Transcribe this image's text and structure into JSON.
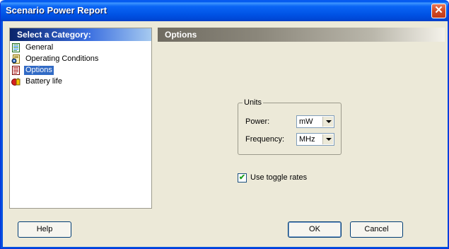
{
  "window": {
    "title": "Scenario Power Report",
    "close_glyph": "✕"
  },
  "sidebar": {
    "header": "Select a Category:",
    "items": [
      {
        "label": "General",
        "icon": "document-icon",
        "selected": false
      },
      {
        "label": "Operating Conditions",
        "icon": "settings-document-icon",
        "selected": false
      },
      {
        "label": "Options",
        "icon": "options-document-icon",
        "selected": true
      },
      {
        "label": "Battery life",
        "icon": "battery-icon",
        "selected": false
      }
    ]
  },
  "options": {
    "header": "Options",
    "units": {
      "legend": "Units",
      "power_label": "Power:",
      "power_value": "mW",
      "frequency_label": "Frequency:",
      "frequency_value": "MHz"
    },
    "toggle": {
      "label": "Use toggle rates",
      "checked": true,
      "check_glyph": "✔"
    }
  },
  "buttons": {
    "help": "Help",
    "ok": "OK",
    "cancel": "Cancel"
  },
  "colors": {
    "selection": "#316ac5",
    "titlebar": "#0a5df2",
    "window_bg": "#ece9d8"
  }
}
